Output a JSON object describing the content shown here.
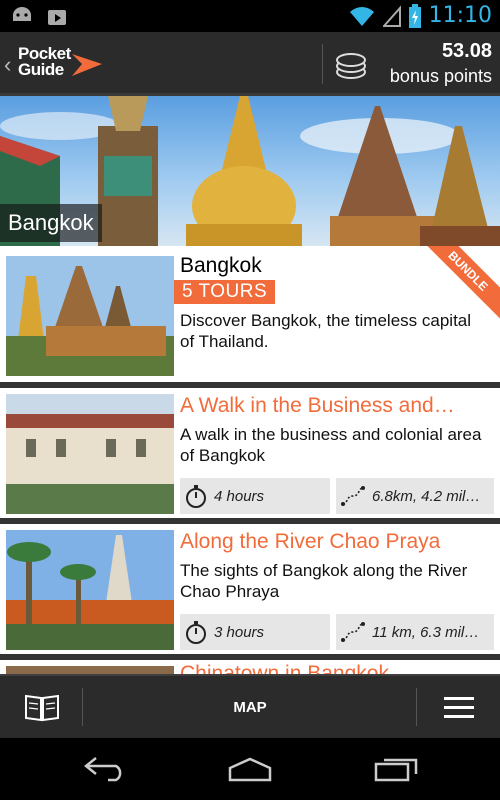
{
  "status_bar": {
    "time": "11:10"
  },
  "header": {
    "logo_line1": "Pocket",
    "logo_line2": "Guide",
    "points_value": "53.08",
    "points_label": "bonus points"
  },
  "hero": {
    "city_label": "Bangkok"
  },
  "cards": [
    {
      "title": "Bangkok",
      "badge": "5 TOURS",
      "ribbon": "BUNDLE",
      "description": "Discover Bangkok, the timeless capital of Thailand."
    },
    {
      "title": "A Walk in the Business and…",
      "description": "A walk in the business and colonial area of Bangkok",
      "duration": "4 hours",
      "distance": "6.8km, 4.2 mil…"
    },
    {
      "title": "Along the River Chao Praya",
      "description": "The sights of Bangkok along the River Chao Phraya",
      "duration": "3 hours",
      "distance": "11 km, 6.3 mil…"
    },
    {
      "title": "Chinatown in Bangkok"
    }
  ],
  "bottom_bar": {
    "map_label": "MAP"
  },
  "colors": {
    "accent": "#f26b3a",
    "header_bg": "#2b2b2b",
    "status_blue": "#33b5e5"
  },
  "icons": [
    "android-icon",
    "play-store-icon",
    "wifi-icon",
    "signal-icon",
    "battery-icon",
    "logo-arrow-icon",
    "coin-stack-icon",
    "stopwatch-icon",
    "route-icon",
    "book-icon",
    "menu-icon",
    "nav-back-icon",
    "nav-home-icon",
    "nav-recent-icon"
  ]
}
